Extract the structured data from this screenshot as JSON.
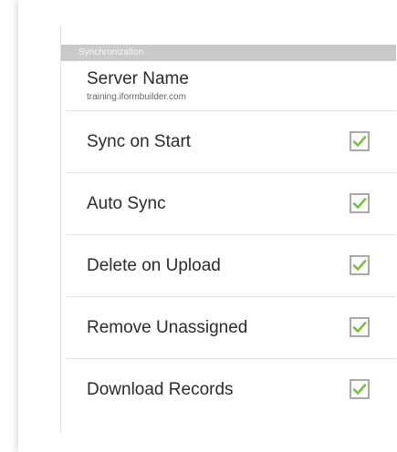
{
  "section": {
    "title": "Synchronization"
  },
  "server": {
    "title": "Server Name",
    "value": "training.iformbuilder.com"
  },
  "settings": [
    {
      "label": "Sync on Start",
      "checked": true
    },
    {
      "label": "Auto Sync",
      "checked": true
    },
    {
      "label": "Delete on Upload",
      "checked": true
    },
    {
      "label": "Remove Unassigned",
      "checked": true
    },
    {
      "label": "Download Records",
      "checked": true
    }
  ],
  "colors": {
    "header": "#c9c9c9",
    "check": "#7bc043",
    "divider": "#e3e3e3"
  },
  "icons": {
    "checkbox": "check-icon"
  }
}
